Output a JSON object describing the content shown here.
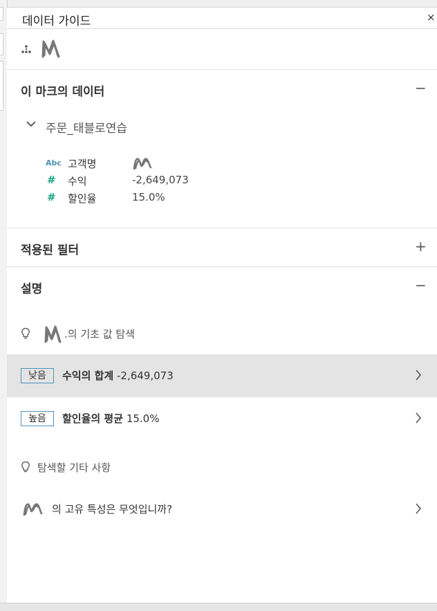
{
  "panel": {
    "title": "데이터 가이드",
    "close_glyph": "×"
  },
  "marks_section": {
    "title": "이 마크의 데이터",
    "toggle": "−",
    "datasource": "주문_태블로연습",
    "fields": [
      {
        "type_label": "Abc",
        "type": "text",
        "name": "고객명",
        "value": ""
      },
      {
        "type_label": "#",
        "type": "number",
        "name": "수익",
        "value": "-2,649,073"
      },
      {
        "type_label": "#",
        "type": "number",
        "name": "할인율",
        "value": "15.0%"
      }
    ]
  },
  "filters_section": {
    "title": "적용된 필터",
    "toggle": "+"
  },
  "explain_section": {
    "title": "설명",
    "toggle": "−",
    "explore_label": ".의 기초 값 탐색",
    "insights": [
      {
        "badge": "낮음",
        "name": "수익의 합계",
        "value": "-2,649,073",
        "selected": true
      },
      {
        "badge": "높음",
        "name": "할인율의 평균",
        "value": "15.0%",
        "selected": false
      }
    ],
    "more_label": "탐색할 기타 사항",
    "question": "의 고유 특성은 무엇입니까?"
  },
  "colors": {
    "badge_border": "#4d8fbd",
    "number_icon": "#1aa38a",
    "text_icon": "#4e93b5",
    "selected_row": "#e4e4e4"
  }
}
